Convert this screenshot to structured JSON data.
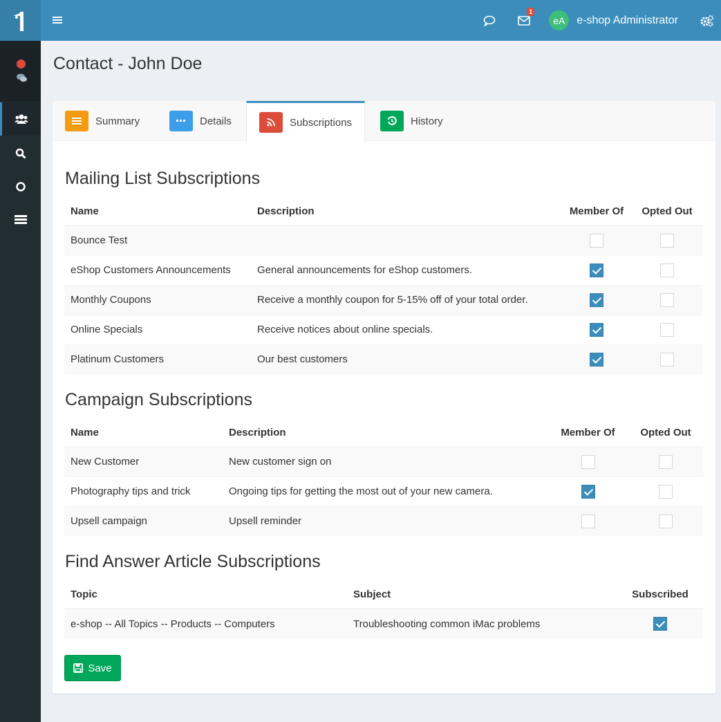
{
  "topbar": {
    "badge_count": "1",
    "avatar_initials": "eA",
    "user_name": "e-shop Administrator"
  },
  "page": {
    "title": "Contact - John Doe"
  },
  "tabs": [
    {
      "label": "Summary",
      "color": "#f39c12"
    },
    {
      "label": "Details",
      "color": "#3c9ee8"
    },
    {
      "label": "Subscriptions",
      "color": "#dd4b39"
    },
    {
      "label": "History",
      "color": "#00a65a"
    }
  ],
  "mailing": {
    "title": "Mailing List Subscriptions",
    "headers": {
      "name": "Name",
      "description": "Description",
      "member": "Member Of",
      "opted": "Opted Out"
    },
    "rows": [
      {
        "name": "Bounce Test",
        "description": ""
      },
      {
        "name": "eShop Customers Announcements",
        "description": "General announcements for eShop customers."
      },
      {
        "name": "Monthly Coupons",
        "description": "Receive a monthly coupon for 5-15% off of your total order."
      },
      {
        "name": "Online Specials",
        "description": "Receive notices about online specials."
      },
      {
        "name": "Platinum Customers",
        "description": "Our best customers"
      }
    ]
  },
  "campaign": {
    "title": "Campaign Subscriptions",
    "headers": {
      "name": "Name",
      "description": "Description",
      "member": "Member Of",
      "opted": "Opted Out"
    },
    "rows": [
      {
        "name": "New Customer",
        "description": "New customer sign on"
      },
      {
        "name": "Photography tips and trick",
        "description": "Ongoing tips for getting the most out of your new camera."
      },
      {
        "name": "Upsell campaign",
        "description": "Upsell reminder"
      }
    ]
  },
  "findanswer": {
    "title": "Find Answer Article Subscriptions",
    "headers": {
      "topic": "Topic",
      "subject": "Subject",
      "subscribed": "Subscribed"
    },
    "rows": [
      {
        "topic": "e-shop -- All Topics -- Products -- Computers",
        "subject": "Troubleshooting common iMac problems"
      }
    ]
  },
  "save_label": "Save"
}
